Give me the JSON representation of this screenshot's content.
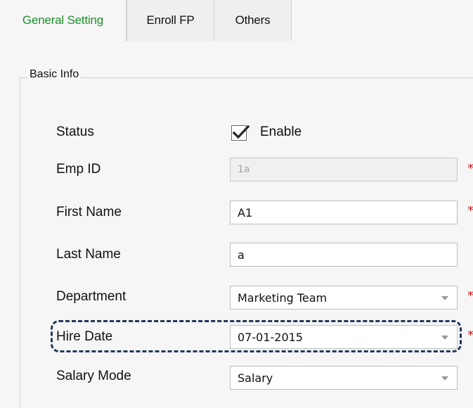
{
  "tabs": [
    {
      "label": "General Setting",
      "active": true
    },
    {
      "label": "Enroll FP",
      "active": false
    },
    {
      "label": "Others",
      "active": false
    }
  ],
  "basic_info": {
    "title": "Basic Info",
    "status": {
      "label": "Status",
      "checked": true,
      "checkbox_label": "Enable"
    },
    "emp_id": {
      "label": "Emp ID",
      "value": "1a",
      "required": true,
      "disabled": true
    },
    "first_name": {
      "label": "First Name",
      "value": "A1",
      "required": true
    },
    "last_name": {
      "label": "Last Name",
      "value": "a",
      "required": false
    },
    "department": {
      "label": "Department",
      "value": "Marketing Team",
      "required": true
    },
    "hire_date": {
      "label": "Hire Date",
      "value": "07-01-2015",
      "required": true,
      "highlighted": true
    },
    "salary_mode": {
      "label": "Salary Mode",
      "value": "Salary",
      "required": false
    }
  },
  "colors": {
    "active_tab_text": "#1f8e2c",
    "required_mark": "#d31d1d",
    "highlight_border": "#22385a"
  },
  "icons": {
    "checkbox_mark": "checkmark-icon",
    "dropdown_arrow": "dropdown-arrow-icon",
    "required_marker": "required-asterisk-icon"
  },
  "required_mark": "*"
}
